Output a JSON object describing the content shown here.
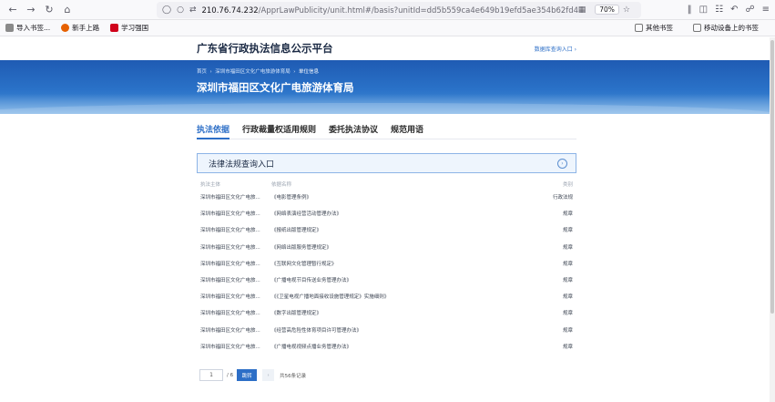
{
  "browser": {
    "url_host": "210.76.74.232",
    "url_rest": "/ApprLawPublicity/unit.html#/basis?unitId=dd5b559ca4e649b19efd5ae354b62fd4&unitName=深",
    "zoom": "70%",
    "bookmarks": [
      "导入书签...",
      "新手上路",
      "学习强国"
    ],
    "bookmarks_right": [
      "其他书签",
      "移动设备上的书签"
    ]
  },
  "site": {
    "title": "广东省行政执法信息公示平台",
    "link": "数据库查询入口 ›",
    "breadcrumb_home": "首页",
    "breadcrumb_mid": "深圳市福田区文化广电旅游体育局",
    "breadcrumb_current": "单位信息",
    "org_name": "深圳市福田区文化广电旅游体育局"
  },
  "tabs": [
    "执法依据",
    "行政裁量权适用规则",
    "委托执法协议",
    "规范用语"
  ],
  "query_title": "法律法规查询入口",
  "table": {
    "headers": [
      "执法主体",
      "依据名称",
      "类别"
    ],
    "rows": [
      [
        "深圳市福田区文化广电旅...",
        "《电影管理条例》",
        "行政法规"
      ],
      [
        "深圳市福田区文化广电旅...",
        "《网络表演经营活动管理办法》",
        "规章"
      ],
      [
        "深圳市福田区文化广电旅...",
        "《报纸出版管理规定》",
        "规章"
      ],
      [
        "深圳市福田区文化广电旅...",
        "《网络出版服务管理规定》",
        "规章"
      ],
      [
        "深圳市福田区文化广电旅...",
        "《互联网文化管理暂行规定》",
        "规章"
      ],
      [
        "深圳市福田区文化广电旅...",
        "《广播电视节目传送业务管理办法》",
        "规章"
      ],
      [
        "深圳市福田区文化广电旅...",
        "《《卫星电视广播地面接收设施管理规定》实施细则》",
        "规章"
      ],
      [
        "深圳市福田区文化广电旅...",
        "《数字出版管理规定》",
        "规章"
      ],
      [
        "深圳市福田区文化广电旅...",
        "《经营高危险性体育项目许可管理办法》",
        "规章"
      ],
      [
        "深圳市福田区文化广电旅...",
        "《广播电视视频点播业务管理办法》",
        "规章"
      ]
    ]
  },
  "pager": {
    "page_value": "1",
    "total_pages": "/ 6",
    "go_label": "跳转",
    "next_label": "›",
    "total_records": "共56条记录"
  }
}
